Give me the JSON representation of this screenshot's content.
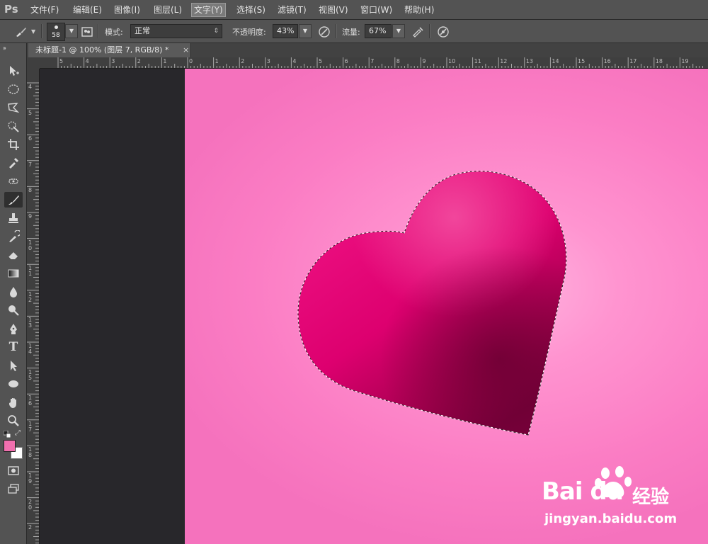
{
  "app": {
    "logo": "Ps"
  },
  "menu": [
    {
      "label": "文件(F)"
    },
    {
      "label": "编辑(E)"
    },
    {
      "label": "图像(I)"
    },
    {
      "label": "图层(L)"
    },
    {
      "label": "文字(Y)",
      "active": true
    },
    {
      "label": "选择(S)"
    },
    {
      "label": "滤镜(T)"
    },
    {
      "label": "视图(V)"
    },
    {
      "label": "窗口(W)"
    },
    {
      "label": "帮助(H)"
    }
  ],
  "options": {
    "brush_size": "58",
    "mode_label": "模式:",
    "mode_value": "正常",
    "opacity_label": "不透明度:",
    "opacity_value": "43%",
    "flow_label": "流量:",
    "flow_value": "67%"
  },
  "document": {
    "tab_title": "未标题-1 @ 100% (图层 7, RGB/8) *",
    "close_glyph": "×"
  },
  "ruler_top_labels": [
    "5",
    "4",
    "3",
    "2",
    "1",
    "0",
    "1",
    "2",
    "3",
    "4",
    "5",
    "6",
    "7",
    "8",
    "9",
    "10",
    "11",
    "12",
    "13",
    "14",
    "15",
    "16",
    "17",
    "18",
    "19"
  ],
  "ruler_left_labels": [
    "4",
    "5",
    "6",
    "7",
    "8",
    "9",
    "1 0",
    "1 1",
    "1 2",
    "1 3",
    "1 4",
    "1 5",
    "1 6",
    "1 7",
    "1 8",
    "1 9",
    "2 0",
    "2"
  ],
  "tools": [
    {
      "name": "move-tool-icon"
    },
    {
      "name": "marquee-tool-icon"
    },
    {
      "name": "lasso-tool-icon"
    },
    {
      "name": "quick-select-tool-icon"
    },
    {
      "name": "crop-tool-icon"
    },
    {
      "name": "eyedropper-tool-icon"
    },
    {
      "name": "spot-healing-tool-icon"
    },
    {
      "name": "brush-tool-icon",
      "selected": true
    },
    {
      "name": "clone-stamp-tool-icon"
    },
    {
      "name": "history-brush-tool-icon"
    },
    {
      "name": "eraser-tool-icon"
    },
    {
      "name": "gradient-tool-icon"
    },
    {
      "name": "blur-tool-icon"
    },
    {
      "name": "dodge-tool-icon"
    },
    {
      "name": "pen-tool-icon"
    },
    {
      "name": "type-tool-icon"
    },
    {
      "name": "path-select-tool-icon"
    },
    {
      "name": "ellipse-tool-icon"
    },
    {
      "name": "hand-tool-icon"
    },
    {
      "name": "zoom-tool-icon"
    }
  ],
  "type_tool_glyph": "T",
  "colors": {
    "foreground": "#f06fae",
    "background": "#ffffff",
    "canvas_pink": "#f77ec4",
    "heart": "#e0006e"
  },
  "watermark": {
    "brand": "Bai du",
    "brand_cn": "经验",
    "url": "jingyan.baidu.com"
  }
}
